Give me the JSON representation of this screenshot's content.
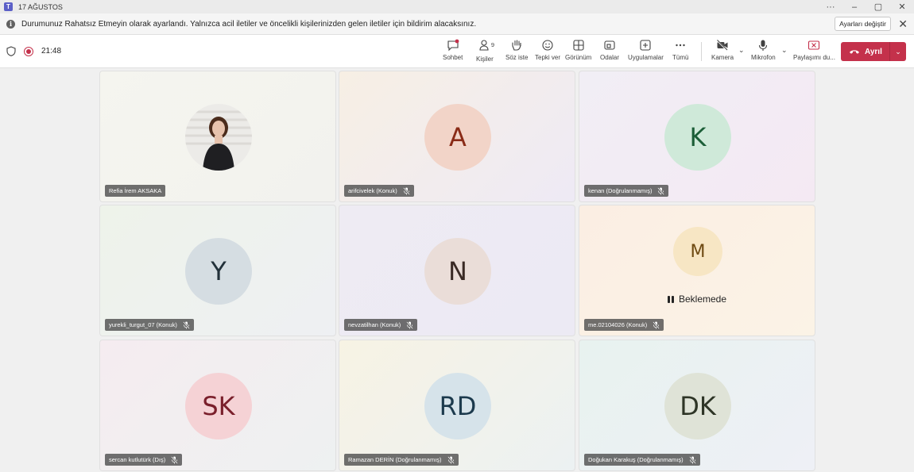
{
  "window": {
    "title": "17 AĞUSTOS"
  },
  "notice": {
    "text": "Durumunuz Rahatsız Etmeyin olarak ayarlandı. Yalnızca acil iletiler ve öncelikli kişilerinizden gelen iletiler için bildirim alacaksınız.",
    "button": "Ayarları değiştir"
  },
  "toolbar": {
    "timer": "21:48",
    "people_count": "9",
    "items": {
      "chat": "Sohbet",
      "people": "Kişiler",
      "raise": "Söz iste",
      "react": "Tepki ver",
      "view": "Görünüm",
      "rooms": "Odalar",
      "apps": "Uygulamalar",
      "more": "Tümü",
      "camera": "Kamera",
      "mic": "Mikrofon",
      "share": "Paylaşımı du..."
    },
    "leave": "Ayrıl"
  },
  "participants": [
    {
      "name": "Refia İrem AKSAKA",
      "initials": "",
      "photo": true,
      "muted": false,
      "bg": "#f4f5f0",
      "avatar_bg": "#d9c9bb",
      "avatar_fg": "#333"
    },
    {
      "name": "arifcivelek (Konuk)",
      "initials": "A",
      "muted": true,
      "bg": "#f6f1ea",
      "avatar_bg": "#f2d4c8",
      "avatar_fg": "#8a2b17"
    },
    {
      "name": "kenan (Doğrulanmamış)",
      "initials": "K",
      "muted": true,
      "bg": "#f4eef4",
      "avatar_bg": "#cfe9d9",
      "avatar_fg": "#1b5e37"
    },
    {
      "name": "yurekli_turgut_07 (Konuk)",
      "initials": "Y",
      "muted": true,
      "bg": "#f0f3ee",
      "avatar_bg": "#d5dde2",
      "avatar_fg": "#22313a"
    },
    {
      "name": "nevzatilhan (Konuk)",
      "initials": "N",
      "muted": true,
      "bg": "#eeecf3",
      "avatar_bg": "#eaddd8",
      "avatar_fg": "#3a2a25"
    },
    {
      "name": "me.02104026 (Konuk)",
      "initials": "M",
      "muted": true,
      "paused": true,
      "paused_text": "Beklemede",
      "bg": "#faf1e7",
      "avatar_bg": "#f7e6c4",
      "avatar_fg": "#6e4a12"
    },
    {
      "name": "sercan kutlutürk (Dış)",
      "initials": "SK",
      "muted": true,
      "bg": "#f3eef1",
      "avatar_bg": "#f5d2d5",
      "avatar_fg": "#7a1f2b"
    },
    {
      "name": "Ramazan DERİN (Doğrulanmamış)",
      "initials": "RD",
      "muted": true,
      "bg": "#f6f3e8",
      "avatar_bg": "#d6e3ea",
      "avatar_fg": "#1c3a4d"
    },
    {
      "name": "Doğukan Karakuş (Doğrulanmamış)",
      "initials": "DK",
      "muted": true,
      "bg": "#edf2f1",
      "avatar_bg": "#dfe3d7",
      "avatar_fg": "#2e3526"
    }
  ]
}
